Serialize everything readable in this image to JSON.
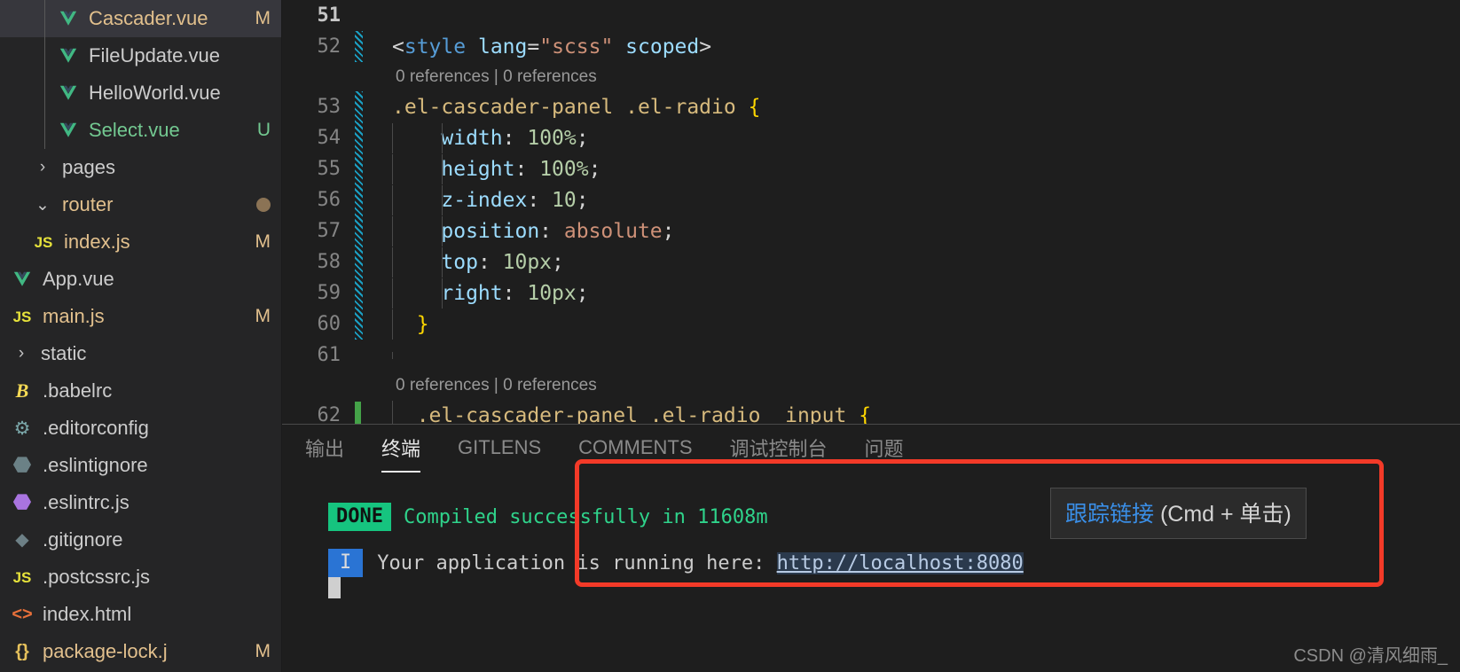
{
  "sidebar": {
    "items": [
      {
        "label": "Cascader.vue",
        "icon": "vue-icon",
        "badge": "M",
        "indent": 3,
        "selected": true,
        "color": "#e2c08d",
        "guide": true
      },
      {
        "label": "FileUpdate.vue",
        "icon": "vue-icon",
        "badge": "",
        "indent": 3,
        "selected": false,
        "color": "#cccccc",
        "guide": true
      },
      {
        "label": "HelloWorld.vue",
        "icon": "vue-icon",
        "badge": "",
        "indent": 3,
        "selected": false,
        "color": "#cccccc",
        "guide": true
      },
      {
        "label": "Select.vue",
        "icon": "vue-icon",
        "badge": "U",
        "indent": 3,
        "selected": false,
        "color": "#73c991",
        "guide": true
      },
      {
        "label": "pages",
        "icon": "chevron-right-icon",
        "badge": "",
        "indent": 2,
        "selected": false,
        "color": "#cccccc",
        "guide": false
      },
      {
        "label": "router",
        "icon": "chevron-down-icon",
        "badge": "dot",
        "indent": 2,
        "selected": false,
        "color": "#e2c08d",
        "guide": false
      },
      {
        "label": "index.js",
        "icon": "js-icon",
        "badge": "M",
        "indent": 2,
        "selected": false,
        "color": "#e2c08d",
        "guide": false
      },
      {
        "label": "App.vue",
        "icon": "vue-icon",
        "badge": "",
        "indent": 1,
        "selected": false,
        "color": "#cccccc",
        "guide": false
      },
      {
        "label": "main.js",
        "icon": "js-icon",
        "badge": "M",
        "indent": 1,
        "selected": false,
        "color": "#e2c08d",
        "guide": false
      },
      {
        "label": "static",
        "icon": "chevron-right-icon",
        "badge": "",
        "indent": 1,
        "selected": false,
        "color": "#cccccc",
        "guide": false
      },
      {
        "label": ".babelrc",
        "icon": "babel-icon",
        "badge": "",
        "indent": 1,
        "selected": false,
        "color": "#cccccc",
        "guide": false
      },
      {
        "label": ".editorconfig",
        "icon": "gear-icon",
        "badge": "",
        "indent": 1,
        "selected": false,
        "color": "#cccccc",
        "guide": false
      },
      {
        "label": ".eslintignore",
        "icon": "eslint-gray-icon",
        "badge": "",
        "indent": 1,
        "selected": false,
        "color": "#cccccc",
        "guide": false
      },
      {
        "label": ".eslintrc.js",
        "icon": "eslint-purple-icon",
        "badge": "",
        "indent": 1,
        "selected": false,
        "color": "#cccccc",
        "guide": false
      },
      {
        "label": ".gitignore",
        "icon": "git-icon",
        "badge": "",
        "indent": 1,
        "selected": false,
        "color": "#cccccc",
        "guide": false
      },
      {
        "label": ".postcssrc.js",
        "icon": "js-icon",
        "badge": "",
        "indent": 1,
        "selected": false,
        "color": "#cccccc",
        "guide": false
      },
      {
        "label": "index.html",
        "icon": "html-icon",
        "badge": "",
        "indent": 1,
        "selected": false,
        "color": "#cccccc",
        "guide": false
      },
      {
        "label": "package-lock.j",
        "icon": "json-icon",
        "badge": "M",
        "indent": 1,
        "selected": false,
        "color": "#e2c08d",
        "guide": false
      }
    ]
  },
  "editor": {
    "lines": [
      {
        "num": "51",
        "diff": "none",
        "current": true,
        "guides": 0,
        "tokens": []
      },
      {
        "num": "52",
        "diff": "mod",
        "current": false,
        "guides": 0,
        "tokens": [
          {
            "t": "<",
            "c": "t-punct"
          },
          {
            "t": "style",
            "c": "t-tag"
          },
          {
            "t": " ",
            "c": "t-punct"
          },
          {
            "t": "lang",
            "c": "t-attr"
          },
          {
            "t": "=",
            "c": "t-punct"
          },
          {
            "t": "\"scss\"",
            "c": "t-str"
          },
          {
            "t": " ",
            "c": "t-punct"
          },
          {
            "t": "scoped",
            "c": "t-attr"
          },
          {
            "t": ">",
            "c": "t-punct"
          }
        ]
      },
      {
        "num": "53",
        "diff": "mod",
        "current": false,
        "guides": 0,
        "tokens": [
          {
            "t": ".el-cascader-panel .el-radio ",
            "c": "t-sel"
          },
          {
            "t": "{",
            "c": "t-brace"
          }
        ]
      },
      {
        "num": "54",
        "diff": "mod",
        "current": false,
        "guides": 2,
        "tokens": [
          {
            "t": "    ",
            "c": "t-punct"
          },
          {
            "t": "width",
            "c": "t-prop"
          },
          {
            "t": ": ",
            "c": "t-punct"
          },
          {
            "t": "100%",
            "c": "t-val"
          },
          {
            "t": ";",
            "c": "t-punct"
          }
        ]
      },
      {
        "num": "55",
        "diff": "mod",
        "current": false,
        "guides": 2,
        "tokens": [
          {
            "t": "    ",
            "c": "t-punct"
          },
          {
            "t": "height",
            "c": "t-prop"
          },
          {
            "t": ": ",
            "c": "t-punct"
          },
          {
            "t": "100%",
            "c": "t-val"
          },
          {
            "t": ";",
            "c": "t-punct"
          }
        ]
      },
      {
        "num": "56",
        "diff": "mod",
        "current": false,
        "guides": 2,
        "tokens": [
          {
            "t": "    ",
            "c": "t-punct"
          },
          {
            "t": "z-index",
            "c": "t-prop"
          },
          {
            "t": ": ",
            "c": "t-punct"
          },
          {
            "t": "10",
            "c": "t-val"
          },
          {
            "t": ";",
            "c": "t-punct"
          }
        ]
      },
      {
        "num": "57",
        "diff": "mod",
        "current": false,
        "guides": 2,
        "tokens": [
          {
            "t": "    ",
            "c": "t-punct"
          },
          {
            "t": "position",
            "c": "t-prop"
          },
          {
            "t": ": ",
            "c": "t-punct"
          },
          {
            "t": "absolute",
            "c": "t-kw"
          },
          {
            "t": ";",
            "c": "t-punct"
          }
        ]
      },
      {
        "num": "58",
        "diff": "mod",
        "current": false,
        "guides": 2,
        "tokens": [
          {
            "t": "    ",
            "c": "t-punct"
          },
          {
            "t": "top",
            "c": "t-prop"
          },
          {
            "t": ": ",
            "c": "t-punct"
          },
          {
            "t": "10px",
            "c": "t-val"
          },
          {
            "t": ";",
            "c": "t-punct"
          }
        ]
      },
      {
        "num": "59",
        "diff": "mod",
        "current": false,
        "guides": 2,
        "tokens": [
          {
            "t": "    ",
            "c": "t-punct"
          },
          {
            "t": "right",
            "c": "t-prop"
          },
          {
            "t": ": ",
            "c": "t-punct"
          },
          {
            "t": "10px",
            "c": "t-val"
          },
          {
            "t": ";",
            "c": "t-punct"
          }
        ]
      },
      {
        "num": "60",
        "diff": "mod",
        "current": false,
        "guides": 1,
        "tokens": [
          {
            "t": "  ",
            "c": "t-punct"
          },
          {
            "t": "}",
            "c": "t-brace"
          }
        ]
      },
      {
        "num": "61",
        "diff": "none",
        "current": false,
        "guides": 1,
        "tokens": []
      },
      {
        "num": "62",
        "diff": "add",
        "current": false,
        "guides": 1,
        "tokens": [
          {
            "t": "  .el-cascader-panel .el-radio__input ",
            "c": "t-sel"
          },
          {
            "t": "{",
            "c": "t-brace"
          }
        ]
      }
    ],
    "codelens_after_52": "0 references | 0 references",
    "codelens_after_61": "0 references | 0 references"
  },
  "panel": {
    "tabs": [
      {
        "label": "输出",
        "active": false
      },
      {
        "label": "终端",
        "active": true
      },
      {
        "label": "GITLENS",
        "active": false
      },
      {
        "label": "COMMENTS",
        "active": false
      },
      {
        "label": "调试控制台",
        "active": false
      },
      {
        "label": "问题",
        "active": false
      }
    ],
    "terminal": {
      "done_badge": "DONE",
      "done_text": "Compiled successfully in 11608m",
      "info_badge": "I",
      "info_text": "Your application is running here: ",
      "info_link": "http://localhost:8080"
    }
  },
  "tooltip": {
    "link_text": "跟踪链接",
    "hint_text": " (Cmd + 单击)"
  },
  "annotation": {
    "color": "#f33a28"
  },
  "watermark": {
    "text": "CSDN @清风细雨_"
  }
}
